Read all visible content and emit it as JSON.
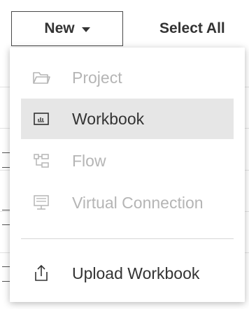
{
  "toolbar": {
    "new_label": "New",
    "select_all_label": "Select All"
  },
  "menu": {
    "items": [
      {
        "label": "Project",
        "icon": "folder-icon",
        "disabled": true
      },
      {
        "label": "Workbook",
        "icon": "workbook-icon",
        "disabled": false,
        "selected": true
      },
      {
        "label": "Flow",
        "icon": "flow-icon",
        "disabled": true
      },
      {
        "label": "Virtual Connection",
        "icon": "virtual-connection-icon",
        "disabled": true
      }
    ],
    "upload": {
      "label": "Upload Workbook",
      "icon": "upload-icon"
    }
  },
  "colors": {
    "disabled_text": "#b5b5b5",
    "enabled_text": "#333333",
    "selected_background": "#e6e6e6",
    "link_blue": "#1f5fb8"
  }
}
